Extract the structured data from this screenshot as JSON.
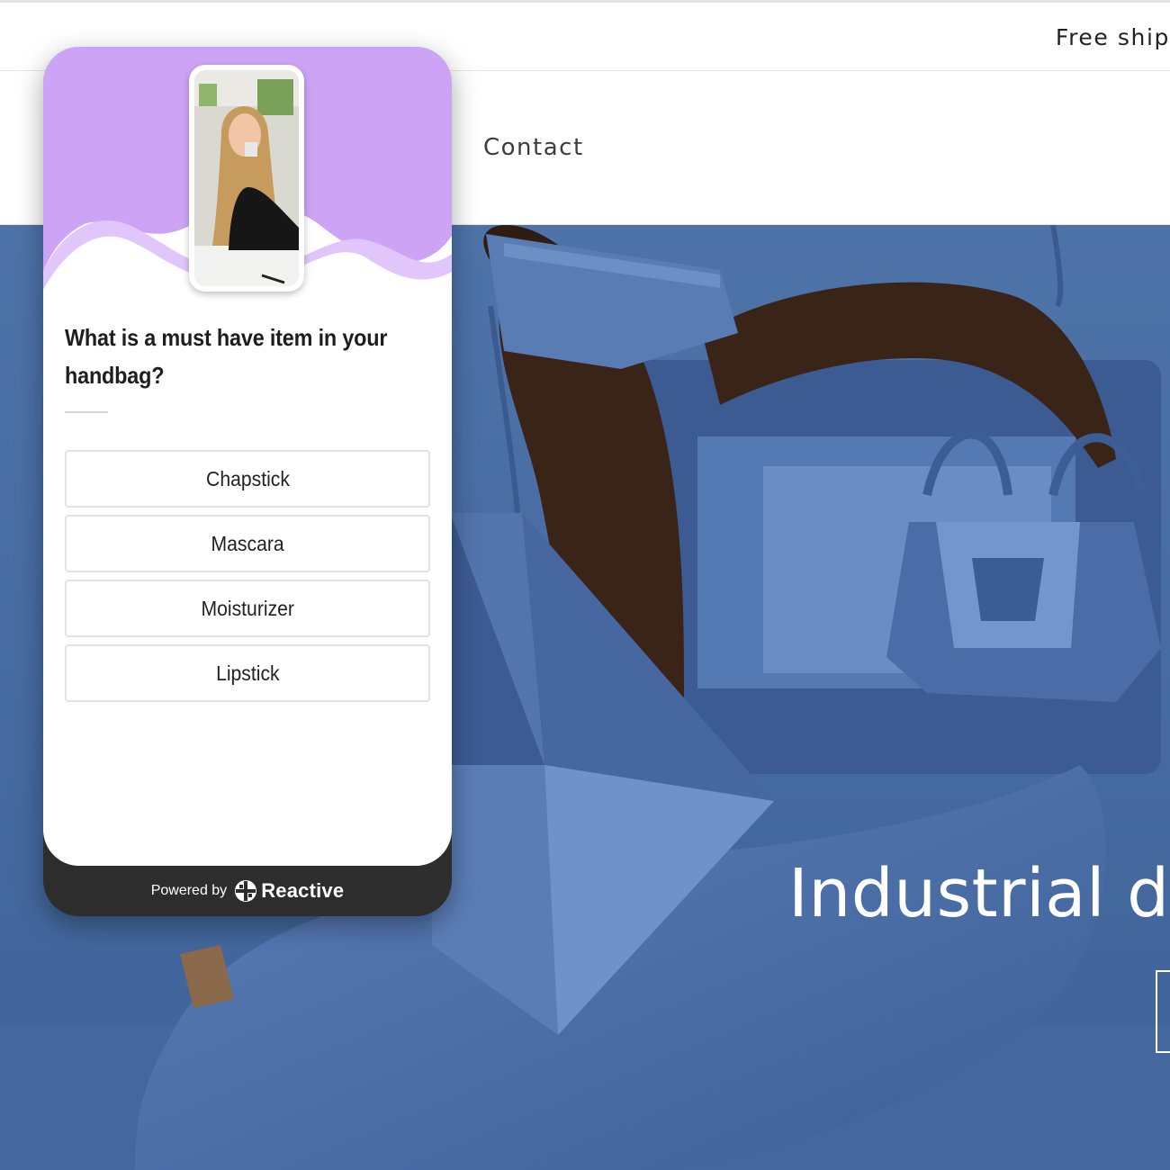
{
  "announcement": {
    "text": "Free ship"
  },
  "nav": {
    "contact": "Contact"
  },
  "hero": {
    "title": "Industrial de"
  },
  "widget": {
    "question": "What is a must have item in your handbag?",
    "options": [
      "Chapstick",
      "Mascara",
      "Moisturizer",
      "Lipstick"
    ],
    "powered_by": "Powered by",
    "brand": "Reactive",
    "header_color": "#cda3f5"
  }
}
